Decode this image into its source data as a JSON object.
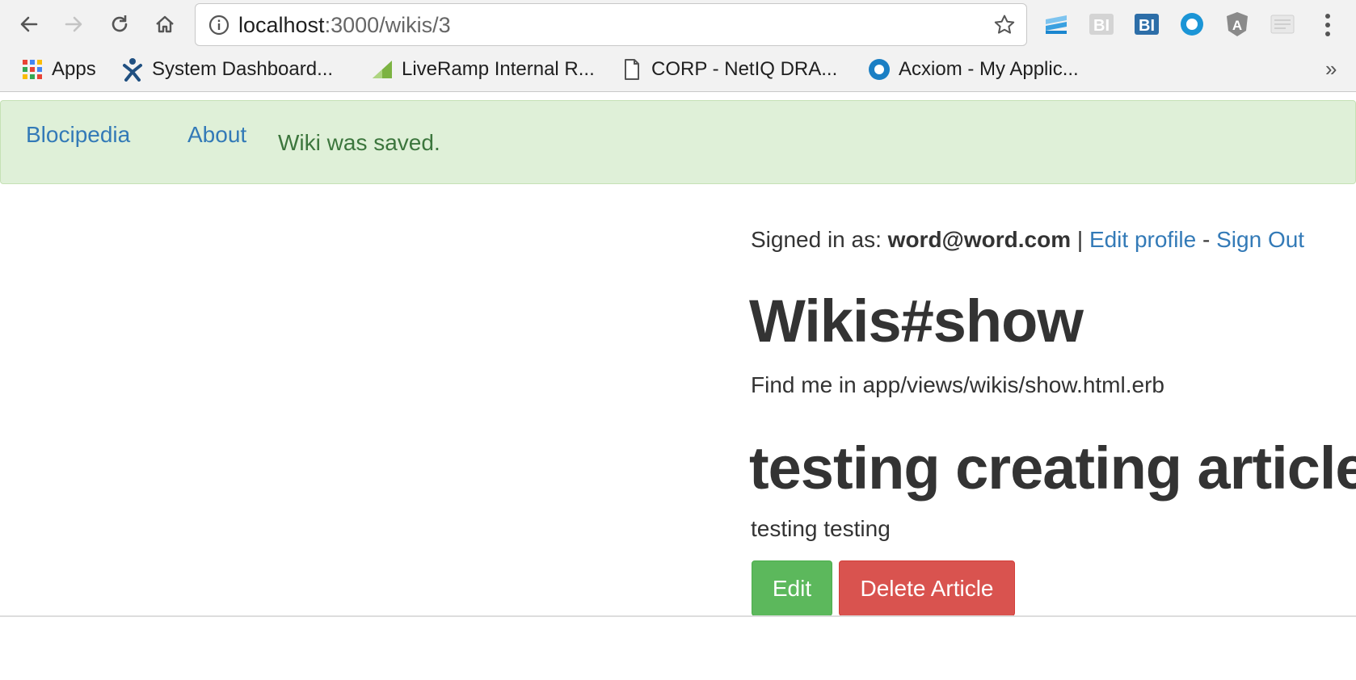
{
  "browser": {
    "url_host": "localhost",
    "url_path": ":3000/wikis/3",
    "bookmarks": [
      {
        "label": "Apps",
        "icon": "apps-grid-icon"
      },
      {
        "label": "System Dashboard...",
        "icon": "jira-icon"
      },
      {
        "label": "LiveRamp Internal R...",
        "icon": "liveramp-icon"
      },
      {
        "label": "CORP - NetIQ DRA...",
        "icon": "document-icon"
      },
      {
        "label": "Acxiom - My Applic...",
        "icon": "acxiom-icon"
      }
    ],
    "more_bookmarks": "»",
    "extensions": [
      "stack-extension-icon",
      "bi-grey-extension-icon",
      "bi-blue-extension-icon",
      "ring-extension-icon",
      "angular-extension-icon",
      "card-extension-icon"
    ]
  },
  "navbar": {
    "brand": "Blocipedia",
    "about": "About",
    "flash": "Wiki was saved."
  },
  "user": {
    "prefix": "Signed in as:",
    "email": "word@word.com",
    "separator": "|",
    "edit_profile": "Edit profile",
    "dash": "-",
    "sign_out": "Sign Out"
  },
  "main": {
    "page_title": "Wikis#show",
    "hint": "Find me in app/views/wikis/show.html.erb",
    "wiki_title": "testing creating article",
    "wiki_body": "testing testing",
    "edit_label": "Edit",
    "delete_label": "Delete Article"
  },
  "colors": {
    "link": "#337ab7",
    "success_bg": "#dff0d8",
    "success_text": "#3c763d",
    "edit_button": "#5cb85c",
    "delete_button": "#d9534f"
  }
}
